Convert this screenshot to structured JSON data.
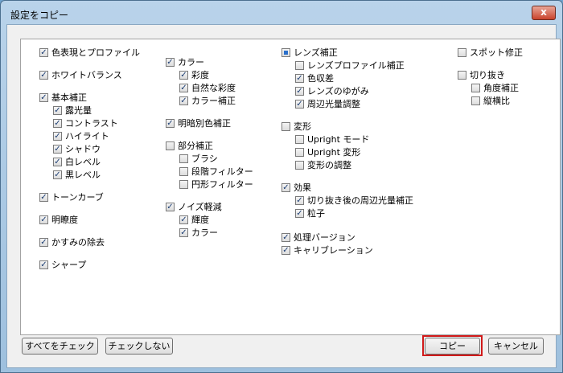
{
  "window": {
    "title": "設定をコピー",
    "close_glyph": "x"
  },
  "columns": [
    {
      "items": [
        {
          "label": "色表現とプロファイル",
          "checked": true
        },
        {
          "label": "ホワイトバランス",
          "checked": true
        },
        {
          "label": "基本補正",
          "checked": true
        },
        {
          "label": "露光量",
          "checked": true
        },
        {
          "label": "コントラスト",
          "checked": true
        },
        {
          "label": "ハイライト",
          "checked": true
        },
        {
          "label": "シャドウ",
          "checked": true
        },
        {
          "label": "白レベル",
          "checked": true
        },
        {
          "label": "黒レベル",
          "checked": true
        },
        {
          "label": "トーンカーブ",
          "checked": true
        },
        {
          "label": "明瞭度",
          "checked": true
        },
        {
          "label": "かすみの除去",
          "checked": true
        },
        {
          "label": "シャープ",
          "checked": true
        }
      ]
    },
    {
      "items": [
        {
          "label": "カラー",
          "checked": true
        },
        {
          "label": "彩度",
          "checked": true
        },
        {
          "label": "自然な彩度",
          "checked": true
        },
        {
          "label": "カラー補正",
          "checked": true
        },
        {
          "label": "明暗別色補正",
          "checked": true
        },
        {
          "label": "部分補正",
          "checked": false
        },
        {
          "label": "ブラシ",
          "checked": false
        },
        {
          "label": "段階フィルター",
          "checked": false
        },
        {
          "label": "円形フィルター",
          "checked": false
        },
        {
          "label": "ノイズ軽減",
          "checked": true
        },
        {
          "label": "輝度",
          "checked": true
        },
        {
          "label": "カラー",
          "checked": true
        }
      ]
    },
    {
      "items": [
        {
          "label": "レンズ補正",
          "checked": "mixed"
        },
        {
          "label": "レンズプロファイル補正",
          "checked": false
        },
        {
          "label": "色収差",
          "checked": true
        },
        {
          "label": "レンズのゆがみ",
          "checked": true
        },
        {
          "label": "周辺光量調整",
          "checked": true
        },
        {
          "label": "変形",
          "checked": false
        },
        {
          "label": "Upright モード",
          "checked": false
        },
        {
          "label": "Upright 変形",
          "checked": false
        },
        {
          "label": "変形の調整",
          "checked": false
        },
        {
          "label": "効果",
          "checked": true
        },
        {
          "label": "切り抜き後の周辺光量補正",
          "checked": true
        },
        {
          "label": "粒子",
          "checked": true
        },
        {
          "label": "処理バージョン",
          "checked": true
        },
        {
          "label": "キャリブレーション",
          "checked": true
        }
      ]
    },
    {
      "items": [
        {
          "label": "スポット修正",
          "checked": false
        },
        {
          "label": "切り抜き",
          "checked": false
        },
        {
          "label": "角度補正",
          "checked": false
        },
        {
          "label": "縦横比",
          "checked": false
        }
      ]
    }
  ],
  "buttons": {
    "check_all": "すべてをチェック",
    "check_none": "チェックしない",
    "copy": "コピー",
    "cancel": "キャンセル"
  },
  "check_glyph": "✓"
}
